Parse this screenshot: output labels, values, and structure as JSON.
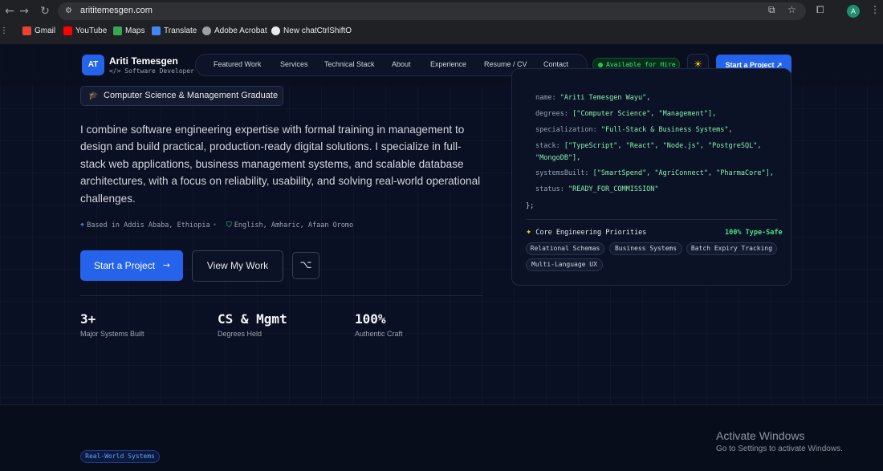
{
  "browser": {
    "url": "arititemesgen.com",
    "profile_initial": "A",
    "bookmarks": [
      {
        "label": "Gmail",
        "color": "#ea4335"
      },
      {
        "label": "YouTube",
        "color": "#ff0000"
      },
      {
        "label": "Maps",
        "color": "#34a853"
      },
      {
        "label": "Translate",
        "color": "#4285f4"
      },
      {
        "label": "Adobe Acrobat",
        "color": "#9aa0a6"
      },
      {
        "label": "New chatCtrlShiftO",
        "color": "#e8eaed"
      }
    ]
  },
  "navbar": {
    "logo_initials": "AT",
    "name": "Ariti Temesgen",
    "subtitle": "</> Software Developer",
    "links": [
      "Featured Work",
      "Services",
      "Technical Stack",
      "About",
      "Experience",
      "Resume / CV",
      "Contact"
    ],
    "availability": "Available for Hire",
    "cta": "Start a Project ↗"
  },
  "hero": {
    "badge": "Computer Science & Management Graduate",
    "intro": "I combine software engineering expertise with formal training in management to design and build practical, production-ready digital solutions. I specialize in full-stack web applications, business management systems, and scalable database architectures, with a focus on reliability, usability, and solving real-world operational challenges.",
    "location": "Based in Addis Ababa, Ethiopia",
    "languages": "English, Amharic, Afaan Oromo",
    "primary_button": "Start a Project",
    "secondary_button": "View My Work",
    "stats": [
      {
        "value": "3+",
        "label": "Major Systems Built"
      },
      {
        "value": "CS & Mgmt",
        "label": "Degrees Held"
      },
      {
        "value": "100%",
        "label": "Authentic Craft"
      }
    ]
  },
  "code_card": {
    "name_key": "name:",
    "name_val": "\"Ariti Temesgen Wayu\"",
    "degrees_key": "degrees:",
    "degrees_val": "[\"Computer Science\", \"Management\"],",
    "spec_key": "specialization:",
    "spec_val": "\"Full-Stack & Business Systems\",",
    "stack_key": "stack:",
    "stack_val": "[\"TypeScript\", \"React\", \"Node.js\", \"PostgreSQL\",",
    "stack_val2": "\"MongoDB\"],",
    "systems_key": "systemsBuilt:",
    "systems_val": "[\"SmartSpend\", \"AgriConnect\", \"PharmaCore\"],",
    "status_key": "status:",
    "status_val": "\"READY_FOR_COMMISSION\"",
    "closing": "};",
    "priorities_title": "Core Engineering Priorities",
    "type_safe": "100% Type-Safe",
    "tags": [
      "Relational Schemas",
      "Business Systems",
      "Batch Expiry Tracking",
      "Multi-Language UX"
    ]
  },
  "next_section": {
    "badge": "Real-World Systems"
  },
  "watermark": {
    "title": "Activate Windows",
    "subtitle": "Go to Settings to activate Windows."
  },
  "colors": {
    "accent": "#2563eb",
    "background": "#0a1024",
    "success": "#4ade80"
  }
}
